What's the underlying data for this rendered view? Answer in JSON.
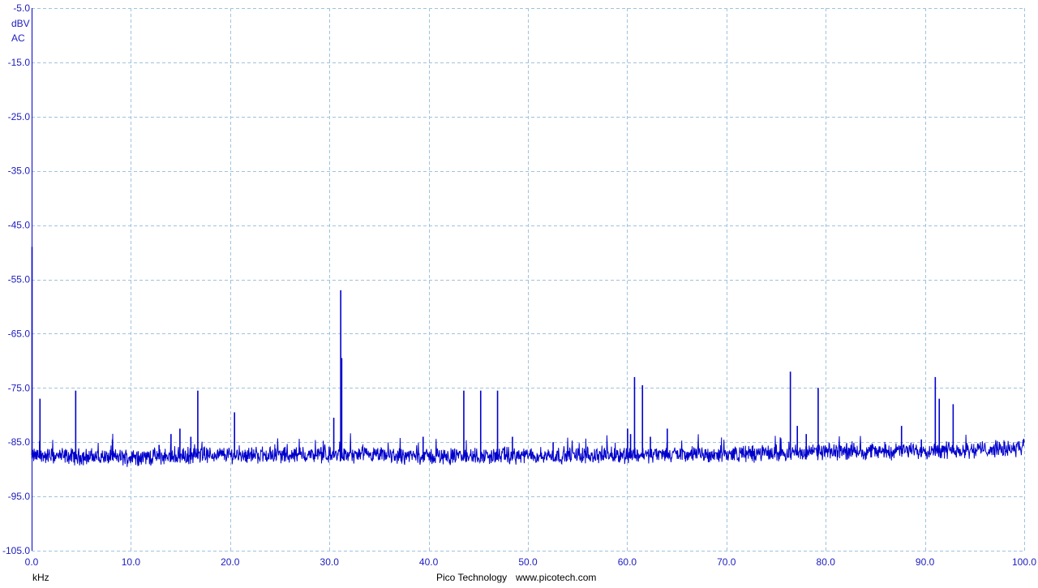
{
  "colors": {
    "trace": "#0000cc",
    "grid": "#9fc3dc",
    "axis_text": "#1c1cbe",
    "footer_text": "#000000",
    "background": "#ffffff"
  },
  "chart_data": {
    "type": "line",
    "title": "",
    "xlabel": "kHz",
    "ylabel_unit": "dBV",
    "ylabel_coupling": "AC",
    "xlim": [
      0,
      100
    ],
    "ylim": [
      -105,
      -5
    ],
    "x_ticks": [
      0,
      10,
      20,
      30,
      40,
      50,
      60,
      70,
      80,
      90,
      100
    ],
    "x_tick_labels": [
      "0.0",
      "10.0",
      "20.0",
      "30.0",
      "40.0",
      "50.0",
      "60.0",
      "70.0",
      "80.0",
      "90.0",
      "100.0"
    ],
    "y_ticks": [
      -5,
      -15,
      -25,
      -35,
      -45,
      -55,
      -65,
      -75,
      -85,
      -95,
      -105
    ],
    "y_tick_labels": [
      "-5.0",
      "-15.0",
      "-25.0",
      "-35.0",
      "-45.0",
      "-55.0",
      "-65.0",
      "-75.0",
      "-85.0",
      "-95.0",
      "-105.0"
    ],
    "grid": true,
    "grid_style": "dashed",
    "noise_floor_dbv": [
      [
        0,
        -87.5
      ],
      [
        10,
        -87.8
      ],
      [
        20,
        -87.3
      ],
      [
        30,
        -87.4
      ],
      [
        40,
        -87.6
      ],
      [
        50,
        -87.5
      ],
      [
        60,
        -87.3
      ],
      [
        70,
        -87.2
      ],
      [
        80,
        -86.8
      ],
      [
        90,
        -86.5
      ],
      [
        100,
        -86.2
      ]
    ],
    "peaks": [
      {
        "x": 0.0,
        "y": -49
      },
      {
        "x": 0.8,
        "y": -77
      },
      {
        "x": 4.4,
        "y": -75.5
      },
      {
        "x": 8.1,
        "y": -84.5
      },
      {
        "x": 12.8,
        "y": -85.5
      },
      {
        "x": 14.0,
        "y": -83.5
      },
      {
        "x": 14.9,
        "y": -82.5
      },
      {
        "x": 16.0,
        "y": -84
      },
      {
        "x": 16.7,
        "y": -75.5
      },
      {
        "x": 20.4,
        "y": -79.5
      },
      {
        "x": 30.4,
        "y": -80.5
      },
      {
        "x": 31.1,
        "y": -57
      },
      {
        "x": 31.2,
        "y": -69.5
      },
      {
        "x": 39.4,
        "y": -84
      },
      {
        "x": 43.5,
        "y": -75.5
      },
      {
        "x": 45.2,
        "y": -75.5
      },
      {
        "x": 46.9,
        "y": -75.5
      },
      {
        "x": 48.4,
        "y": -84
      },
      {
        "x": 52.5,
        "y": -85
      },
      {
        "x": 60.0,
        "y": -82.5
      },
      {
        "x": 60.3,
        "y": -83.5
      },
      {
        "x": 60.7,
        "y": -73
      },
      {
        "x": 61.5,
        "y": -74.5
      },
      {
        "x": 62.3,
        "y": -84
      },
      {
        "x": 64.0,
        "y": -82.5
      },
      {
        "x": 76.4,
        "y": -72
      },
      {
        "x": 77.1,
        "y": -82
      },
      {
        "x": 78.0,
        "y": -83.5
      },
      {
        "x": 79.2,
        "y": -75
      },
      {
        "x": 87.6,
        "y": -82
      },
      {
        "x": 89.6,
        "y": -84.5
      },
      {
        "x": 91.0,
        "y": -73
      },
      {
        "x": 91.4,
        "y": -77
      },
      {
        "x": 92.8,
        "y": -78
      }
    ]
  },
  "footer": {
    "brand": "Pico Technology",
    "url": "www.picotech.com"
  }
}
